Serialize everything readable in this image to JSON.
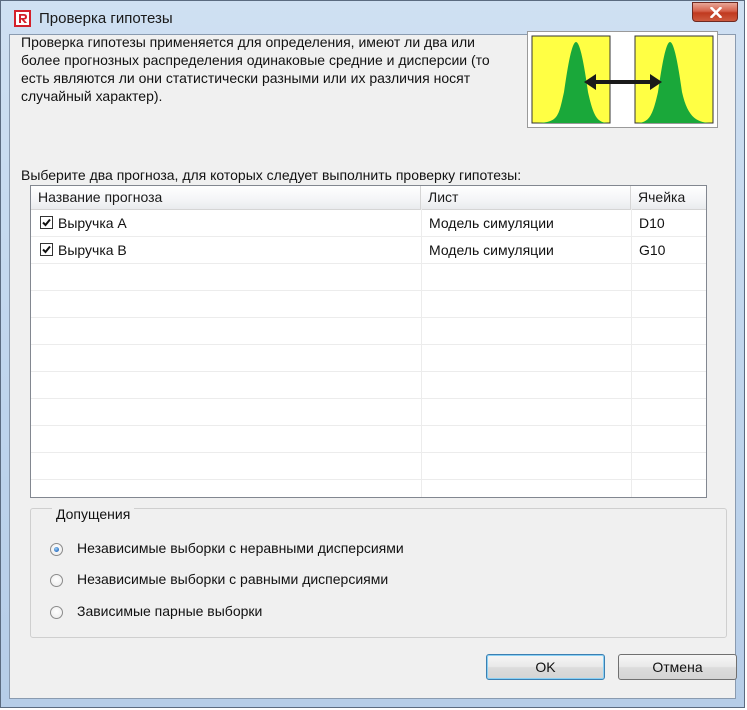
{
  "window": {
    "title": "Проверка гипотезы"
  },
  "description": "Проверка гипотезы применяется для определения, имеют ли два или более прогнозных распределения одинаковые средние и дисперсии (то есть являются ли они статистически разными или их различия носят случайный характер).",
  "instruction": "Выберите два прогноза, для которых следует выполнить проверку гипотезы:",
  "table": {
    "columns": [
      "Название прогноза",
      "Лист",
      "Ячейка"
    ],
    "rows": [
      {
        "checked": true,
        "name": "Выручка A",
        "sheet": "Модель симуляции",
        "cell": "D10"
      },
      {
        "checked": true,
        "name": "Выручка B",
        "sheet": "Модель симуляции",
        "cell": "G10"
      }
    ]
  },
  "assumptions": {
    "title": "Допущения",
    "options": [
      {
        "label": "Независимые выборки с неравными дисперсиями",
        "selected": true
      },
      {
        "label": "Независимые выборки с равными дисперсиями",
        "selected": false
      },
      {
        "label": "Зависимые парные выборки",
        "selected": false
      }
    ]
  },
  "buttons": {
    "ok": "OK",
    "cancel": "Отмена"
  },
  "icons": {
    "app": "app-logo-icon",
    "close": "close-icon",
    "illustration": "distribution-compare-icon"
  },
  "colors": {
    "illustration_bg": "#ffff33",
    "curve": "#1aa83a"
  }
}
